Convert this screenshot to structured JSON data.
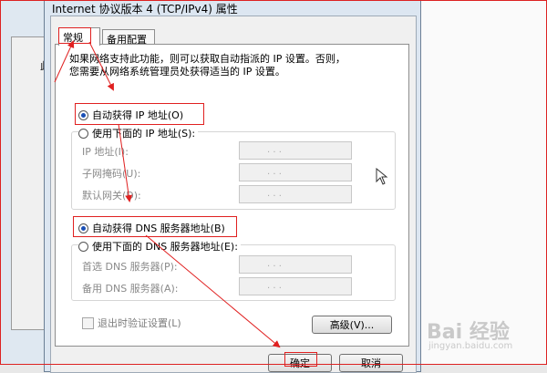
{
  "dialog": {
    "title": "Internet 协议版本 4 (TCP/IPv4) 属性",
    "tabs": [
      {
        "label": "常规",
        "active": true
      },
      {
        "label": "备用配置",
        "active": false
      }
    ],
    "description_line1": "如果网络支持此功能，则可以获取自动指派的 IP 设置。否则，",
    "description_line2": "您需要从网络系统管理员处获得适当的 IP 设置。",
    "ip_auto": {
      "label": "自动获得 IP 地址(O)",
      "checked": true
    },
    "ip_manual": {
      "label": "使用下面的 IP 地址(S):",
      "checked": false
    },
    "ip_fields": [
      {
        "label": "IP 地址(I):",
        "value": ". . ."
      },
      {
        "label": "子网掩码(U):",
        "value": ". . ."
      },
      {
        "label": "默认网关(D):",
        "value": ". . ."
      }
    ],
    "dns_auto": {
      "label": "自动获得 DNS 服务器地址(B)",
      "checked": true
    },
    "dns_manual": {
      "label": "使用下面的 DNS 服务器地址(E):",
      "checked": false
    },
    "dns_fields": [
      {
        "label": "首选 DNS 服务器(P):",
        "value": ". . ."
      },
      {
        "label": "备用 DNS 服务器(A):",
        "value": ". . ."
      }
    ],
    "validate_checkbox": {
      "label": "退出时验证设置(L)",
      "checked": false
    },
    "advanced_button": "高级(V)...",
    "ok_button": "确定",
    "cancel_button": "取消"
  },
  "background": {
    "side_text": "此"
  },
  "watermark": {
    "text": "Bai 经验",
    "sub": "jingyan.baidu.com"
  },
  "colors": {
    "annotation_red": "#e02020",
    "radio_dot": "#1a4fb5",
    "dialog_frame": "#dce6f1"
  }
}
